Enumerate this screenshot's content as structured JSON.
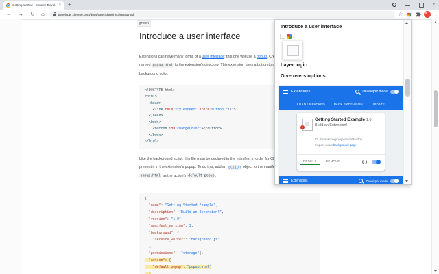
{
  "browser": {
    "tab": {
      "title": "Getting started - Chrome Devel...",
      "close_glyph": "×"
    },
    "new_tab_glyph": "+",
    "window_controls": {
      "close_glyph": "×"
    },
    "toolbar": {
      "back_glyph": "←",
      "forward_glyph": "→",
      "reload_glyph": "↻",
      "home_glyph": "⌂",
      "url": "developer.chrome.com/docs/extensions/mv3/getstarted/",
      "bookmark_glyph": "☆",
      "menu_glyph": "⋮"
    }
  },
  "page": {
    "inline_code_top": "green",
    "heading": "Introduce a user interface",
    "para1": {
      "lines": [
        {
          "segments": [
            {
              "t": "Extensions can have many forms of a "
            },
            {
              "t": "user interface",
              "type": "link"
            },
            {
              "t": "; this one will use a "
            },
            {
              "t": "popup",
              "type": "link"
            },
            {
              "t": ". Create and add a file"
            }
          ]
        },
        {
          "segments": [
            {
              "t": "named "
            },
            {
              "t": "popup.html",
              "type": "code"
            },
            {
              "t": " to the extension's directory. This extension uses a button to change the"
            }
          ]
        },
        {
          "segments": [
            {
              "t": "background color."
            }
          ]
        }
      ]
    },
    "code1": {
      "lines": [
        {
          "tokens": [
            {
              "t": "<!DOCTYPE html>",
              "c": "d"
            }
          ]
        },
        {
          "tokens": [
            {
              "t": "<",
              "c": "p"
            },
            {
              "t": "html",
              "c": "t"
            },
            {
              "t": ">",
              "c": "p"
            }
          ]
        },
        {
          "tokens": [
            {
              "t": "  <",
              "c": "p"
            },
            {
              "t": "head",
              "c": "t"
            },
            {
              "t": ">",
              "c": "p"
            }
          ]
        },
        {
          "tokens": [
            {
              "t": "    <",
              "c": "p"
            },
            {
              "t": "link",
              "c": "t"
            },
            {
              "t": " ",
              "c": "p"
            },
            {
              "t": "rel=",
              "c": "a"
            },
            {
              "t": "\"stylesheet\"",
              "c": "s"
            },
            {
              "t": " ",
              "c": "p"
            },
            {
              "t": "href=",
              "c": "a"
            },
            {
              "t": "\"button.css\"",
              "c": "s"
            },
            {
              "t": ">",
              "c": "p"
            }
          ]
        },
        {
          "tokens": [
            {
              "t": "  </",
              "c": "p"
            },
            {
              "t": "head",
              "c": "t"
            },
            {
              "t": ">",
              "c": "p"
            }
          ]
        },
        {
          "tokens": [
            {
              "t": "  <",
              "c": "p"
            },
            {
              "t": "body",
              "c": "t"
            },
            {
              "t": ">",
              "c": "p"
            }
          ]
        },
        {
          "tokens": [
            {
              "t": "    <",
              "c": "p"
            },
            {
              "t": "button",
              "c": "t"
            },
            {
              "t": " ",
              "c": "p"
            },
            {
              "t": "id=",
              "c": "a"
            },
            {
              "t": "\"changeColor\"",
              "c": "s"
            },
            {
              "t": "></",
              "c": "p"
            },
            {
              "t": "button",
              "c": "t"
            },
            {
              "t": ">",
              "c": "p"
            }
          ]
        },
        {
          "tokens": [
            {
              "t": "  </",
              "c": "p"
            },
            {
              "t": "body",
              "c": "t"
            },
            {
              "t": ">",
              "c": "p"
            }
          ]
        },
        {
          "tokens": [
            {
              "t": "</",
              "c": "p"
            },
            {
              "t": "html",
              "c": "t"
            },
            {
              "t": ">",
              "c": "p"
            }
          ]
        }
      ]
    },
    "para2": {
      "lines": [
        {
          "segments": [
            {
              "t": "Like the background script, this file must be declared in the manifest in order for Chrome to"
            }
          ]
        },
        {
          "segments": [
            {
              "t": "present it in the extension's popup. To do this, add an "
            },
            {
              "t": "action",
              "type": "linkcode"
            },
            {
              "t": " object to the manifest and set"
            }
          ]
        },
        {
          "segments": [
            {
              "t": "popup.html",
              "type": "code"
            },
            {
              "t": " as the action's "
            },
            {
              "t": "default_popup",
              "type": "code"
            },
            {
              "t": "."
            }
          ]
        }
      ]
    },
    "code2": {
      "lines": [
        {
          "tokens": [
            {
              "t": "{",
              "c": "p"
            }
          ]
        },
        {
          "tokens": [
            {
              "t": "  ",
              "c": "p"
            },
            {
              "t": "\"name\"",
              "c": "k"
            },
            {
              "t": ": ",
              "c": "p"
            },
            {
              "t": "\"Getting Started Example\"",
              "c": "s"
            },
            {
              "t": ",",
              "c": "p"
            }
          ]
        },
        {
          "tokens": [
            {
              "t": "  ",
              "c": "p"
            },
            {
              "t": "\"description\"",
              "c": "k"
            },
            {
              "t": ": ",
              "c": "p"
            },
            {
              "t": "\"Build an Extension!\"",
              "c": "s"
            },
            {
              "t": ",",
              "c": "p"
            }
          ]
        },
        {
          "tokens": [
            {
              "t": "  ",
              "c": "p"
            },
            {
              "t": "\"version\"",
              "c": "k"
            },
            {
              "t": ": ",
              "c": "p"
            },
            {
              "t": "\"1.0\"",
              "c": "s"
            },
            {
              "t": ",",
              "c": "p"
            }
          ]
        },
        {
          "tokens": [
            {
              "t": "  ",
              "c": "p"
            },
            {
              "t": "\"manifest_version\"",
              "c": "k"
            },
            {
              "t": ": ",
              "c": "p"
            },
            {
              "t": "3",
              "c": "n"
            },
            {
              "t": ",",
              "c": "p"
            }
          ]
        },
        {
          "tokens": [
            {
              "t": "  ",
              "c": "p"
            },
            {
              "t": "\"background\"",
              "c": "k"
            },
            {
              "t": ": {",
              "c": "p"
            }
          ]
        },
        {
          "tokens": [
            {
              "t": "    ",
              "c": "p"
            },
            {
              "t": "\"service_worker\"",
              "c": "k"
            },
            {
              "t": ": ",
              "c": "p"
            },
            {
              "t": "\"background.js\"",
              "c": "s"
            }
          ]
        },
        {
          "tokens": [
            {
              "t": "  },",
              "c": "p"
            }
          ]
        },
        {
          "tokens": [
            {
              "t": "  ",
              "c": "p"
            },
            {
              "t": "\"permissions\"",
              "c": "k"
            },
            {
              "t": ": [",
              "c": "p"
            },
            {
              "t": "\"storage\"",
              "c": "s"
            },
            {
              "t": "],",
              "c": "p"
            }
          ]
        },
        {
          "hl": true,
          "tokens": [
            {
              "t": "  ",
              "c": "p"
            },
            {
              "t": "\"action\"",
              "c": "k"
            },
            {
              "t": ": {",
              "c": "p"
            }
          ]
        },
        {
          "hl": true,
          "tokens": [
            {
              "t": "    ",
              "c": "p"
            },
            {
              "t": "\"default_popup\"",
              "c": "k"
            },
            {
              "t": ": ",
              "c": "p"
            },
            {
              "t": "\"popup.html\"",
              "c": "s"
            }
          ]
        },
        {
          "hl": true,
          "tokens": [
            {
              "t": "  }",
              "c": "p"
            }
          ]
        }
      ]
    }
  },
  "panel": {
    "toc_heading": "Introduce a user interface",
    "toc_items": [
      "Layer logic",
      "Give users options"
    ],
    "overflow_glyph": "⋮",
    "extensions_ui": {
      "title": "Extensions",
      "developer_mode_label": "Developer mode",
      "toolbar_buttons": [
        "LOAD UNPACKED",
        "PACK EXTENSION",
        "UPDATE"
      ],
      "card": {
        "name": "Getting Started Example",
        "version": "1.0",
        "description": "Build an Extension!",
        "id_line": "ID: rbepmkcongjiniejbceiddolifandbp",
        "inspect_prefix": "Inspect views",
        "inspect_link": "background page",
        "details_label": "DETAILS",
        "remove_label": "REMOVE",
        "error_badge_glyph": "!"
      }
    },
    "extensions_ui_partial": {
      "title": "Extensions",
      "developer_mode_label": "Developer mode"
    }
  },
  "colors": {
    "header_blue": "#1a73e8",
    "link_blue": "#1a73e8",
    "highlight_yellow": "#fbe9a4",
    "details_green": "#188038"
  }
}
